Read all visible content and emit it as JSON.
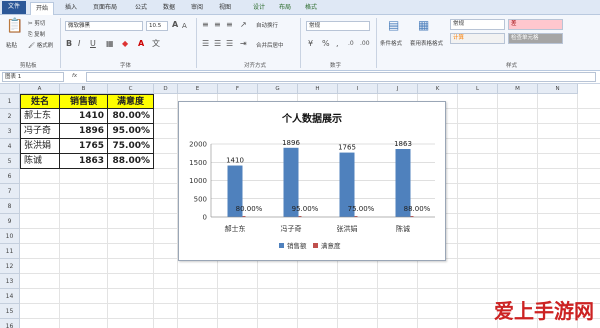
{
  "ribbon_tabs": [
    "文件",
    "开始",
    "插入",
    "页面布局",
    "公式",
    "数据",
    "审阅",
    "视图",
    "设计",
    "布局",
    "格式"
  ],
  "ribbon": {
    "paste_label": "粘贴",
    "cut_label": "剪切",
    "copy_label": "复制",
    "format_painter_label": "格式刷",
    "clipboard_group": "剪贴板",
    "font_name": "微软雅黑",
    "font_size": "10.5",
    "font_group": "字体",
    "wrap_label": "自动换行",
    "merge_label": "合并后居中",
    "align_group": "对齐方式",
    "number_format": "常规",
    "number_group": "数字",
    "conditional_label": "条件格式",
    "table_format_label": "套用表格格式",
    "style_normal": "常规",
    "style_bad": "差",
    "style_calc": "计算",
    "style_check": "检查单元格",
    "style_group": "样式"
  },
  "formula_bar": {
    "name_box": "图表 1",
    "fx": "fx"
  },
  "columns": [
    "A",
    "B",
    "C",
    "D",
    "E",
    "F",
    "G",
    "H",
    "I",
    "J",
    "K",
    "L",
    "M",
    "N"
  ],
  "rows": [
    "1",
    "2",
    "3",
    "4",
    "5",
    "6",
    "7",
    "8",
    "9",
    "10",
    "11",
    "12",
    "13",
    "14",
    "15",
    "16"
  ],
  "table": {
    "headers": [
      "姓名",
      "销售额",
      "满意度"
    ],
    "rows": [
      [
        "郝士东",
        "1410",
        "80.00%"
      ],
      [
        "冯子奇",
        "1896",
        "95.00%"
      ],
      [
        "张洪娟",
        "1765",
        "75.00%"
      ],
      [
        "陈诚",
        "1863",
        "88.00%"
      ]
    ]
  },
  "chart_data": {
    "type": "bar",
    "title": "个人数据展示",
    "categories": [
      "郝士东",
      "冯子奇",
      "张洪娟",
      "陈诚"
    ],
    "series": [
      {
        "name": "销售额",
        "values": [
          1410,
          1896,
          1765,
          1863
        ],
        "labels": [
          "1410",
          "1896",
          "1765",
          "1863"
        ]
      },
      {
        "name": "满意度",
        "values": [
          0.8,
          0.95,
          0.75,
          0.88
        ],
        "labels": [
          "80.00%",
          "95.00%",
          "75.00%",
          "88.00%"
        ]
      }
    ],
    "ylim": [
      0,
      2000
    ],
    "yticks": [
      "0",
      "500",
      "1000",
      "1500",
      "2000"
    ],
    "grid": true,
    "legend": "bottom",
    "colors": {
      "sales": "#4f81bd",
      "satisfaction": "#c0504d"
    }
  },
  "watermark": "爱上手游网"
}
